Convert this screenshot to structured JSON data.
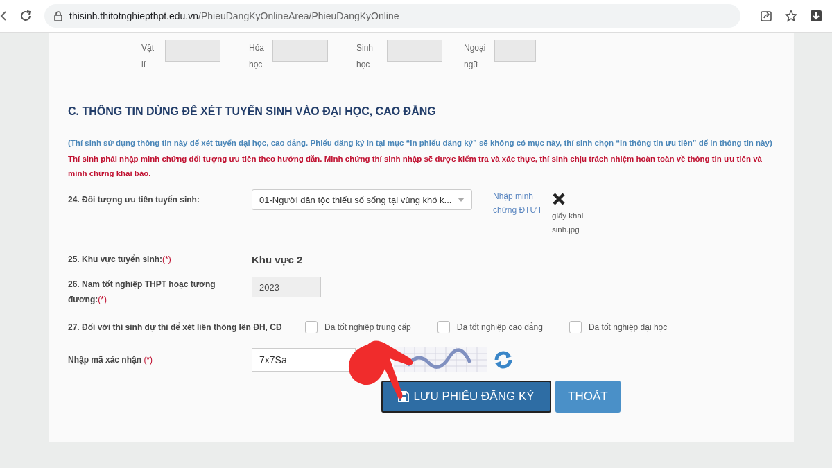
{
  "browser": {
    "url_host": "thisinh.thitotnghiepthpt.edu.vn",
    "url_path": "/PhieuDangKyOnlineArea/PhieuDangKyOnline"
  },
  "subjects": [
    {
      "label": "Vật lí"
    },
    {
      "label": "Hóa học"
    },
    {
      "label": "Sinh học"
    },
    {
      "label": "Ngoại ngữ"
    }
  ],
  "section": {
    "title": "C. THÔNG TIN DÙNG ĐỂ XÉT TUYỂN SINH VÀO ĐẠI HỌC, CAO ĐẲNG",
    "note": "(Thí sinh sử dụng thông tin này để xét tuyển đại học, cao đẳng. Phiếu đăng ký in tại mục “In phiếu đăng ký” sẽ không có mục này, thí sinh chọn “In thông tin ưu tiên” để in thông tin này)",
    "warning": "Thí sinh phải nhập minh chứng đối tượng ưu tiên theo hướng dẫn. Minh chứng thí sinh nhập sẽ được kiểm tra và xác thực, thí sinh chịu trách nhiệm hoàn toàn về thông tin ưu tiên và minh chứng khai báo."
  },
  "priority": {
    "label": "24. Đối tượng ưu tiên tuyển sinh:",
    "value": "01-Người dân tộc thiểu số sống tại vùng khó k...",
    "link": "Nhập minh chứng ĐTƯT",
    "file": "giấy khai sinh.jpg"
  },
  "region": {
    "label": "25. Khu vực tuyển sinh:",
    "required": "(*)",
    "value": "Khu vực 2"
  },
  "graduation": {
    "label": "26. Năm tốt nghiệp THPT hoặc tương đương:",
    "required": "(*)",
    "value": "2023"
  },
  "transfer": {
    "label": "27. Đối với thí sinh dự thi để xét liên thông lên ĐH, CĐ",
    "options": [
      {
        "label": "Đã tốt nghiệp trung cấp",
        "checked": false
      },
      {
        "label": "Đã tốt nghiệp cao đẳng",
        "checked": false
      },
      {
        "label": "Đã tốt nghiệp đại học",
        "checked": false
      }
    ]
  },
  "captcha": {
    "label": "Nhập mã xác nhận",
    "required": "(*)",
    "value": "7x7Sa"
  },
  "buttons": [
    {
      "kind": "save",
      "label": "LƯU PHIẾU ĐĂNG KÝ"
    },
    {
      "kind": "exit",
      "label": "THOÁT"
    }
  ]
}
